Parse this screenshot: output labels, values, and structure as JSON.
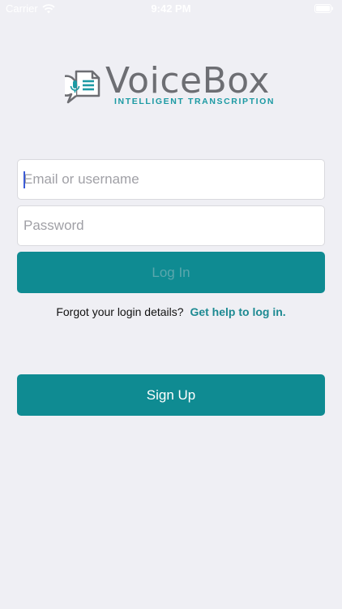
{
  "status_bar": {
    "carrier": "Carrier",
    "time": "9:42 PM"
  },
  "logo": {
    "name": "VoiceBox",
    "tagline": "INTELLIGENT TRANSCRIPTION"
  },
  "form": {
    "email_placeholder": "Email or username",
    "password_placeholder": "Password",
    "login_label": "Log In",
    "forgot_text": "Forgot your login details?",
    "help_link": "Get help to log in."
  },
  "signup_label": "Sign Up",
  "colors": {
    "accent": "#0f8b92",
    "background": "#efeff4",
    "link": "#1d8a92"
  }
}
